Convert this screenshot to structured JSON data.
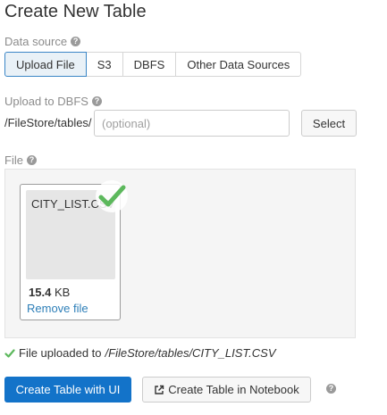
{
  "title": "Create New Table",
  "data_source": {
    "label": "Data source",
    "tabs": [
      {
        "label": "Upload File",
        "active": true
      },
      {
        "label": "S3",
        "active": false
      },
      {
        "label": "DBFS",
        "active": false
      },
      {
        "label": "Other Data Sources",
        "active": false
      }
    ]
  },
  "upload_dbfs": {
    "label": "Upload to DBFS",
    "prefix": "/FileStore/tables/",
    "input_value": "",
    "input_placeholder": "(optional)",
    "select_label": "Select"
  },
  "file": {
    "label": "File",
    "name": "CITY_LIST.CSV",
    "size_value": "15.4",
    "size_unit": "KB",
    "remove_label": "Remove file"
  },
  "status": {
    "text": "File uploaded to",
    "path": "/FileStore/tables/CITY_LIST.CSV"
  },
  "actions": {
    "primary_label": "Create Table with UI",
    "secondary_label": "Create Table in Notebook"
  },
  "icons": {
    "help": "help-circle-icon",
    "check": "check-icon",
    "external_link": "external-link-icon"
  },
  "colors": {
    "primary": "#1373c9",
    "link": "#2e7fb8",
    "success": "#5cb85c",
    "active_tab_border": "#3b86c6"
  }
}
